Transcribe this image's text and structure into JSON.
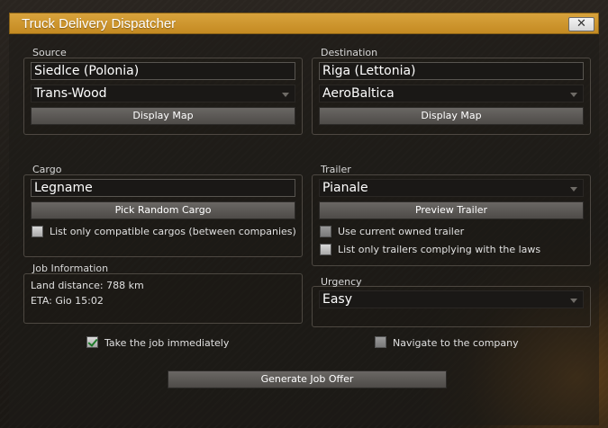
{
  "window": {
    "title": "Truck Delivery Dispatcher",
    "close_label": "✕"
  },
  "source": {
    "group_label": "Source",
    "city_value": "Siedlce (Polonia)",
    "company_value": "Trans-Wood",
    "display_map_label": "Display Map"
  },
  "destination": {
    "group_label": "Destination",
    "city_value": "Riga (Lettonia)",
    "company_value": "AeroBaltica",
    "display_map_label": "Display Map"
  },
  "cargo": {
    "group_label": "Cargo",
    "cargo_value": "Legname",
    "pick_random_label": "Pick Random Cargo",
    "compatible_only_label": "List only compatible cargos (between companies)",
    "compatible_only_checked": false
  },
  "trailer": {
    "group_label": "Trailer",
    "trailer_value": "Pianale",
    "preview_label": "Preview Trailer",
    "use_owned_label": "Use current owned trailer",
    "use_owned_checked": false,
    "laws_only_label": "List only trailers complying with the laws",
    "laws_only_checked": false
  },
  "job_info": {
    "group_label": "Job Information",
    "distance_text": "Land distance: 788 km",
    "eta_text": "ETA: Gio 15:02"
  },
  "urgency": {
    "group_label": "Urgency",
    "value": "Easy"
  },
  "options": {
    "take_job_label": "Take the job immediately",
    "take_job_checked": true,
    "navigate_label": "Navigate to the company",
    "navigate_checked": false
  },
  "generate_label": "Generate Job Offer"
}
